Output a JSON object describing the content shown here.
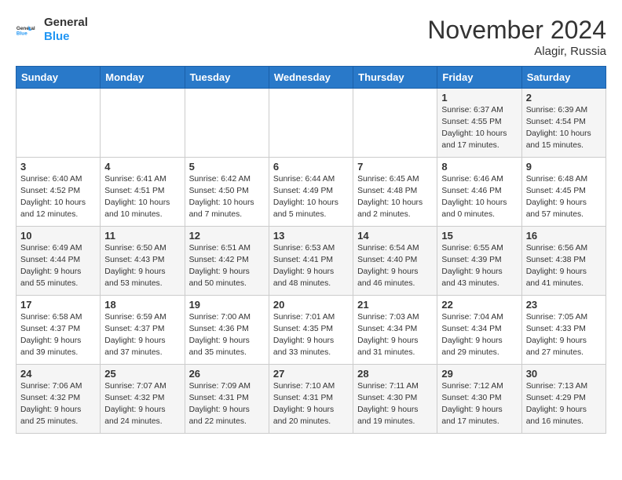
{
  "header": {
    "logo_line1": "General",
    "logo_line2": "Blue",
    "month": "November 2024",
    "location": "Alagir, Russia"
  },
  "weekdays": [
    "Sunday",
    "Monday",
    "Tuesday",
    "Wednesday",
    "Thursday",
    "Friday",
    "Saturday"
  ],
  "weeks": [
    [
      {
        "day": "",
        "info": ""
      },
      {
        "day": "",
        "info": ""
      },
      {
        "day": "",
        "info": ""
      },
      {
        "day": "",
        "info": ""
      },
      {
        "day": "",
        "info": ""
      },
      {
        "day": "1",
        "info": "Sunrise: 6:37 AM\nSunset: 4:55 PM\nDaylight: 10 hours\nand 17 minutes."
      },
      {
        "day": "2",
        "info": "Sunrise: 6:39 AM\nSunset: 4:54 PM\nDaylight: 10 hours\nand 15 minutes."
      }
    ],
    [
      {
        "day": "3",
        "info": "Sunrise: 6:40 AM\nSunset: 4:52 PM\nDaylight: 10 hours\nand 12 minutes."
      },
      {
        "day": "4",
        "info": "Sunrise: 6:41 AM\nSunset: 4:51 PM\nDaylight: 10 hours\nand 10 minutes."
      },
      {
        "day": "5",
        "info": "Sunrise: 6:42 AM\nSunset: 4:50 PM\nDaylight: 10 hours\nand 7 minutes."
      },
      {
        "day": "6",
        "info": "Sunrise: 6:44 AM\nSunset: 4:49 PM\nDaylight: 10 hours\nand 5 minutes."
      },
      {
        "day": "7",
        "info": "Sunrise: 6:45 AM\nSunset: 4:48 PM\nDaylight: 10 hours\nand 2 minutes."
      },
      {
        "day": "8",
        "info": "Sunrise: 6:46 AM\nSunset: 4:46 PM\nDaylight: 10 hours\nand 0 minutes."
      },
      {
        "day": "9",
        "info": "Sunrise: 6:48 AM\nSunset: 4:45 PM\nDaylight: 9 hours\nand 57 minutes."
      }
    ],
    [
      {
        "day": "10",
        "info": "Sunrise: 6:49 AM\nSunset: 4:44 PM\nDaylight: 9 hours\nand 55 minutes."
      },
      {
        "day": "11",
        "info": "Sunrise: 6:50 AM\nSunset: 4:43 PM\nDaylight: 9 hours\nand 53 minutes."
      },
      {
        "day": "12",
        "info": "Sunrise: 6:51 AM\nSunset: 4:42 PM\nDaylight: 9 hours\nand 50 minutes."
      },
      {
        "day": "13",
        "info": "Sunrise: 6:53 AM\nSunset: 4:41 PM\nDaylight: 9 hours\nand 48 minutes."
      },
      {
        "day": "14",
        "info": "Sunrise: 6:54 AM\nSunset: 4:40 PM\nDaylight: 9 hours\nand 46 minutes."
      },
      {
        "day": "15",
        "info": "Sunrise: 6:55 AM\nSunset: 4:39 PM\nDaylight: 9 hours\nand 43 minutes."
      },
      {
        "day": "16",
        "info": "Sunrise: 6:56 AM\nSunset: 4:38 PM\nDaylight: 9 hours\nand 41 minutes."
      }
    ],
    [
      {
        "day": "17",
        "info": "Sunrise: 6:58 AM\nSunset: 4:37 PM\nDaylight: 9 hours\nand 39 minutes."
      },
      {
        "day": "18",
        "info": "Sunrise: 6:59 AM\nSunset: 4:37 PM\nDaylight: 9 hours\nand 37 minutes."
      },
      {
        "day": "19",
        "info": "Sunrise: 7:00 AM\nSunset: 4:36 PM\nDaylight: 9 hours\nand 35 minutes."
      },
      {
        "day": "20",
        "info": "Sunrise: 7:01 AM\nSunset: 4:35 PM\nDaylight: 9 hours\nand 33 minutes."
      },
      {
        "day": "21",
        "info": "Sunrise: 7:03 AM\nSunset: 4:34 PM\nDaylight: 9 hours\nand 31 minutes."
      },
      {
        "day": "22",
        "info": "Sunrise: 7:04 AM\nSunset: 4:34 PM\nDaylight: 9 hours\nand 29 minutes."
      },
      {
        "day": "23",
        "info": "Sunrise: 7:05 AM\nSunset: 4:33 PM\nDaylight: 9 hours\nand 27 minutes."
      }
    ],
    [
      {
        "day": "24",
        "info": "Sunrise: 7:06 AM\nSunset: 4:32 PM\nDaylight: 9 hours\nand 25 minutes."
      },
      {
        "day": "25",
        "info": "Sunrise: 7:07 AM\nSunset: 4:32 PM\nDaylight: 9 hours\nand 24 minutes."
      },
      {
        "day": "26",
        "info": "Sunrise: 7:09 AM\nSunset: 4:31 PM\nDaylight: 9 hours\nand 22 minutes."
      },
      {
        "day": "27",
        "info": "Sunrise: 7:10 AM\nSunset: 4:31 PM\nDaylight: 9 hours\nand 20 minutes."
      },
      {
        "day": "28",
        "info": "Sunrise: 7:11 AM\nSunset: 4:30 PM\nDaylight: 9 hours\nand 19 minutes."
      },
      {
        "day": "29",
        "info": "Sunrise: 7:12 AM\nSunset: 4:30 PM\nDaylight: 9 hours\nand 17 minutes."
      },
      {
        "day": "30",
        "info": "Sunrise: 7:13 AM\nSunset: 4:29 PM\nDaylight: 9 hours\nand 16 minutes."
      }
    ]
  ]
}
